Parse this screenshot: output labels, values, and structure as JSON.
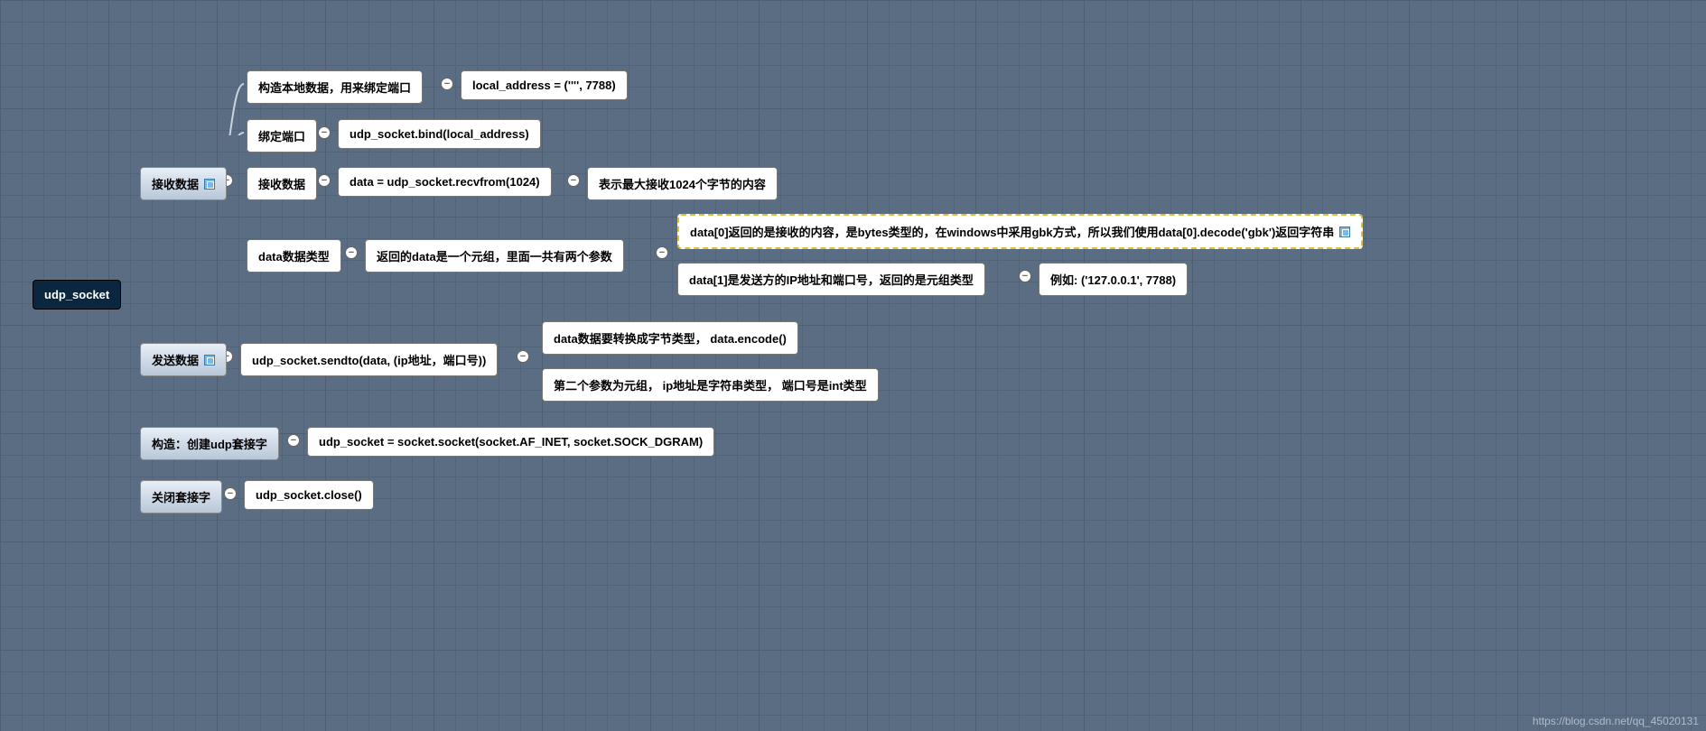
{
  "root": "udp_socket",
  "recv": {
    "label": "接收数据",
    "construct": {
      "label": "构造本地数据，用来绑定端口",
      "code": "local_address = ('''', 7788)"
    },
    "bind": {
      "label": "绑定端口",
      "code": "udp_socket.bind(local_address)"
    },
    "receive": {
      "label": "接收数据",
      "code": "data = udp_socket.recvfrom(1024)",
      "note": "表示最大接收1024个字节的内容"
    },
    "dtype": {
      "label": "data数据类型",
      "ret": "返回的data是一个元组，里面一共有两个参数",
      "d0": "data[0]返回的是接收的内容，是bytes类型的，在windows中采用gbk方式，所以我们使用data[0].decode('gbk')返回字符串",
      "d1": "data[1]是发送方的IP地址和端口号，返回的是元组类型",
      "ex": "例如: ('127.0.0.1', 7788)"
    }
  },
  "send": {
    "label": "发送数据",
    "code": "udp_socket.sendto(data, (ip地址，端口号))",
    "p1": "data数据要转换成字节类型，   data.encode()",
    "p2": "第二个参数为元组， ip地址是字符串类型， 端口号是int类型"
  },
  "make": {
    "label": "构造：创建udp套接字",
    "code": "udp_socket = socket.socket(socket.AF_INET, socket.SOCK_DGRAM)"
  },
  "close": {
    "label": "关闭套接字",
    "code": "udp_socket.close()"
  },
  "watermark": "https://blog.csdn.net/qq_45020131"
}
